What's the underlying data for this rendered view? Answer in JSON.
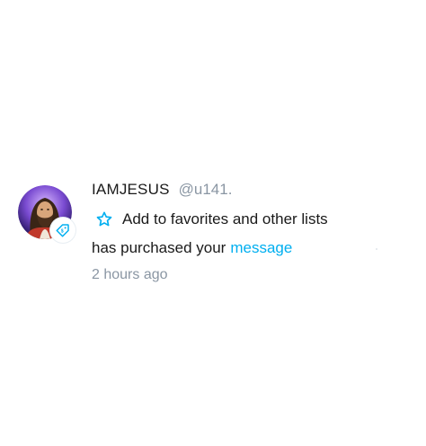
{
  "notification": {
    "display_name": "IAMJESUS",
    "handle": "@u141.",
    "favorites_label": "Add to favorites and other lists",
    "action_text": "has purchased your",
    "action_link": "message",
    "timestamp": "2 hours ago"
  },
  "icons": {
    "avatar": "avatar-image",
    "badge": "price-tag-icon",
    "favorite": "star-outline-icon"
  },
  "colors": {
    "accent": "#00aff0",
    "muted": "#8a96a3",
    "text": "#1a1a1a"
  }
}
